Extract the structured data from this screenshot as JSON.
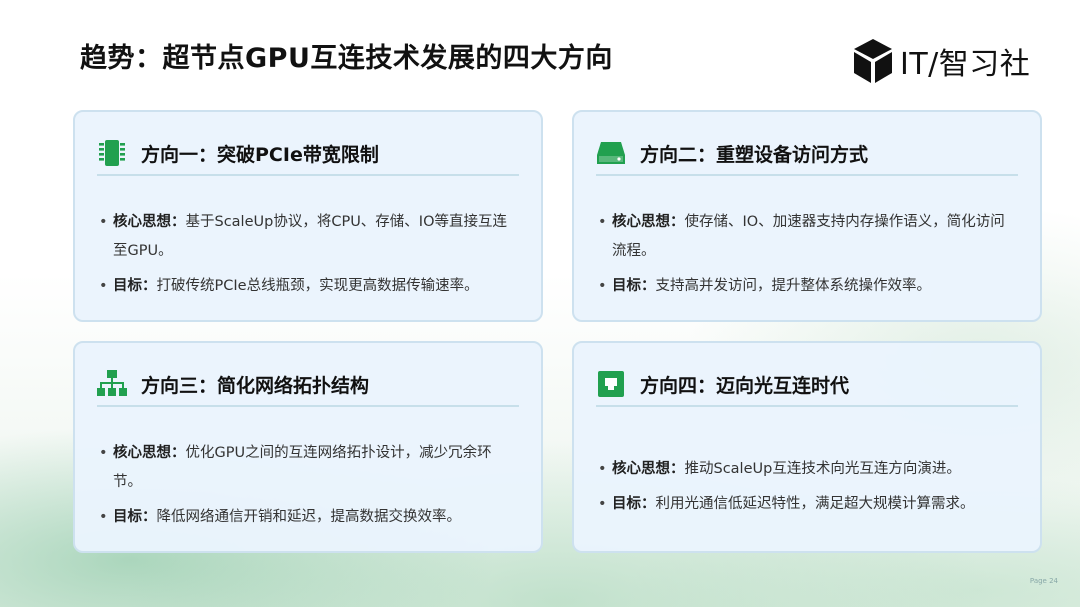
{
  "slide": {
    "title": "趋势：超节点GPU互连技术发展的四大方向",
    "logo_text": "IT/智习社",
    "page": "Page 24"
  },
  "colors": {
    "accent": "#21a04f",
    "card_bg": "#eaf4fd",
    "card_border": "#cde1ef"
  },
  "cards": [
    {
      "icon": "chip-icon",
      "title": "方向一：突破PCIe带宽限制",
      "items": [
        {
          "key": "核心思想：",
          "text": "基于ScaleUp协议，将CPU、存储、IO等直接互连至GPU。"
        },
        {
          "key": "目标：",
          "text": "打破传统PCIe总线瓶颈，实现更高数据传输速率。"
        }
      ]
    },
    {
      "icon": "storage-drive-icon",
      "title": "方向二：重塑设备访问方式",
      "items": [
        {
          "key": "核心思想：",
          "text": "使存储、IO、加速器支持内存操作语义，简化访问流程。"
        },
        {
          "key": "目标：",
          "text": "支持高并发访问，提升整体系统操作效率。"
        }
      ]
    },
    {
      "icon": "network-tree-icon",
      "title": "方向三：简化网络拓扑结构",
      "items": [
        {
          "key": "核心思想：",
          "text": "优化GPU之间的互连网络拓扑设计，减少冗余环节。"
        },
        {
          "key": "目标：",
          "text": "降低网络通信开销和延迟，提高数据交换效率。"
        }
      ]
    },
    {
      "icon": "optical-port-icon",
      "title": "方向四：迈向光互连时代",
      "items": [
        {
          "key": "核心思想：",
          "text": "推动ScaleUp互连技术向光互连方向演进。"
        },
        {
          "key": "目标：",
          "text": "利用光通信低延迟特性，满足超大规模计算需求。"
        }
      ]
    }
  ]
}
